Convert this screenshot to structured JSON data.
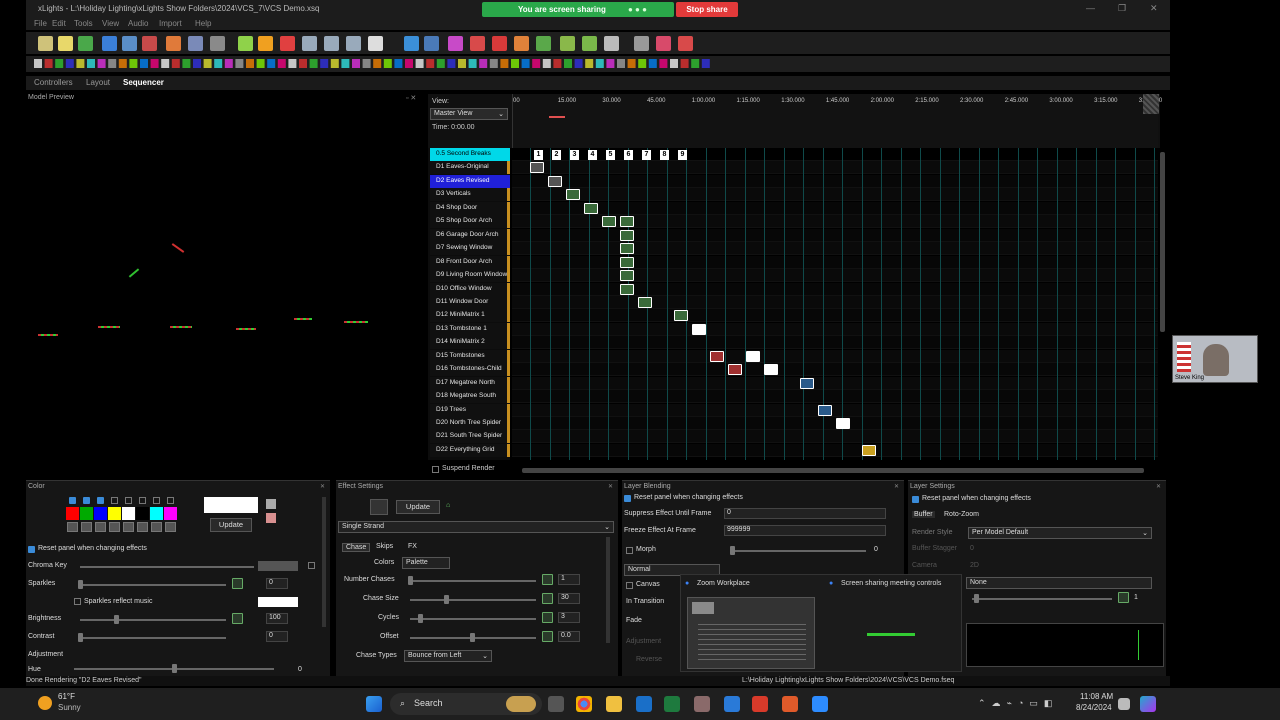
{
  "window": {
    "title": "xLights - L:\\Holiday Lighting\\xLights Show Folders\\2024\\VCS_7\\VCS Demo.xsq",
    "controls": [
      "—",
      "❐",
      "✕"
    ]
  },
  "screen_share": {
    "banner": "You are screen sharing",
    "stop": "Stop share"
  },
  "menu": [
    "File",
    "Edit",
    "Tools",
    "View",
    "Audio",
    "Import",
    "Help"
  ],
  "tabs": [
    {
      "label": "Controllers",
      "active": false
    },
    {
      "label": "Layout",
      "active": false
    },
    {
      "label": "Sequencer",
      "active": true
    }
  ],
  "model_preview": {
    "title": "Model Preview"
  },
  "sequencer": {
    "view_label": "View:",
    "view_select": "Master View",
    "time": "Time: 0:00.00",
    "ruler": [
      "00",
      "15.000",
      "30.000",
      "45.000",
      "1:00.000",
      "1:15.000",
      "1:30.000",
      "1:45.000",
      "2:00.000",
      "2:15.000",
      "2:30.000",
      "2:45.000",
      "3:00.000",
      "3:15.000",
      "3:30.000"
    ],
    "timing_marks": [
      "1",
      "2",
      "3",
      "4",
      "5",
      "6",
      "7",
      "8",
      "9"
    ],
    "rows": [
      {
        "label": "0.5 Second Breaks",
        "style": "timing"
      },
      {
        "label": "D1 Eaves-Original",
        "style": "normal"
      },
      {
        "label": "D2 Eaves Revised",
        "style": "selected"
      },
      {
        "label": "D3 Verticals",
        "style": "normal"
      },
      {
        "label": "D4 Shop Door",
        "style": "normal"
      },
      {
        "label": "D5 Shop Door Arch",
        "style": "normal"
      },
      {
        "label": "D6 Garage Door Arch",
        "style": "normal"
      },
      {
        "label": "D7 Sewing Window",
        "style": "normal"
      },
      {
        "label": "D8 Front Door Arch",
        "style": "normal"
      },
      {
        "label": "D9 Living Room Window",
        "style": "normal"
      },
      {
        "label": "D10 Office Window",
        "style": "normal"
      },
      {
        "label": "D11 Window Door",
        "style": "normal"
      },
      {
        "label": "D12 MiniMatrix 1",
        "style": "normal"
      },
      {
        "label": "D13 Tombstone 1",
        "style": "normal"
      },
      {
        "label": "D14 MiniMatrix 2",
        "style": "normal"
      },
      {
        "label": "D15 Tombstones",
        "style": "normal"
      },
      {
        "label": "D16 Tombstones-Child",
        "style": "normal"
      },
      {
        "label": "D17 Megatree North",
        "style": "normal"
      },
      {
        "label": "D18 Megatree South",
        "style": "normal"
      },
      {
        "label": "D19 Trees",
        "style": "normal"
      },
      {
        "label": "D20 North Tree Spider",
        "style": "normal"
      },
      {
        "label": "D21 South Tree Spider",
        "style": "normal"
      },
      {
        "label": "D22 Everything Grid",
        "style": "normal"
      }
    ],
    "suspend_render": "Suspend Render"
  },
  "color_panel": {
    "title": "Color",
    "update": "Update",
    "reset": "Reset panel when changing effects",
    "chroma_key": "Chroma Key",
    "sparkles": "Sparkles",
    "sparkles_value": "0",
    "sparkles_music": "Sparkles reflect music",
    "brightness": "Brightness",
    "brightness_value": "100",
    "contrast": "Contrast",
    "contrast_value": "0",
    "adjustment": "Adjustment",
    "hue": "Hue",
    "hue_value": "0",
    "palette_colors": [
      "#ff0000",
      "#00aa00",
      "#0000ff",
      "#ffff00",
      "#ffffff",
      "#000000",
      "#00ffff",
      "#ff00ff"
    ]
  },
  "effect_settings": {
    "title": "Effect Settings",
    "update": "Update",
    "effect": "Single Strand",
    "subtabs": [
      "Chase",
      "Skips",
      "FX"
    ],
    "colors_label": "Colors",
    "colors_value": "Palette",
    "num_chases": "Number Chases",
    "num_chases_value": "1",
    "chase_size": "Chase Size",
    "chase_size_value": "30",
    "cycles": "Cycles",
    "cycles_value": "3",
    "offset": "Offset",
    "offset_value": "0.0",
    "chase_types": "Chase Types",
    "chase_types_value": "Bounce from Left"
  },
  "layer_blending": {
    "title": "Layer Blending",
    "reset": "Reset panel when changing effects",
    "suppress": "Suppress Effect Until Frame",
    "suppress_value": "0",
    "freeze": "Freeze Effect At Frame",
    "freeze_value": "999999",
    "morph": "Morph",
    "morph_value": "0",
    "blend_mode": "Normal",
    "canvas": "Canvas",
    "in_transition": "In Transition",
    "fade": "Fade",
    "adjustment": "Adjustment",
    "reverse": "Reverse"
  },
  "layer_settings": {
    "title": "Layer Settings",
    "reset": "Reset panel when changing effects",
    "buffer_tab": "Buffer",
    "roto_tab": "Roto-Zoom",
    "render_style": "Render Style",
    "render_style_value": "Per Model Default",
    "buffer_stagger": "Buffer Stagger",
    "buffer_stagger_value": "0",
    "camera": "Camera",
    "camera_value": "2D",
    "none": "None",
    "value": "1"
  },
  "zoom_popup": {
    "workplace": "Zoom Workplace",
    "controls": "Screen sharing meeting controls"
  },
  "status": {
    "left": "Done Rendering \"D2  Eaves Revised\"",
    "right": "L:\\Holiday Lighting\\xLights Show Folders\\2024\\VCS\\VCS Demo.fseq"
  },
  "weather": {
    "temp": "61°F",
    "desc": "Sunny"
  },
  "taskbar": {
    "search": "Search",
    "time": "11:08 AM",
    "date": "8/24/2024"
  },
  "webcam": {
    "name": "Steve King"
  }
}
